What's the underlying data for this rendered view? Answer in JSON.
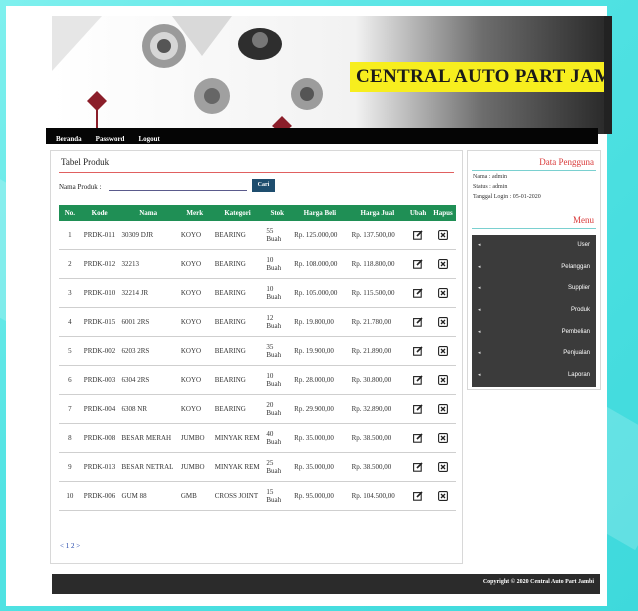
{
  "banner": {
    "title": "CENTRAL AUTO PART JAMBI"
  },
  "nav": {
    "items": [
      "Beranda",
      "Password",
      "Logout"
    ]
  },
  "main": {
    "title": "Tabel Produk",
    "search": {
      "label": "Nama Produk :",
      "value": "",
      "button": "Cari"
    },
    "columns": [
      "No.",
      "Kode",
      "Nama",
      "Merk",
      "Kategori",
      "Stok",
      "Harga Beli",
      "Harga Jual",
      "Ubah",
      "Hapus"
    ],
    "rows": [
      [
        "1",
        "PRDK-011",
        "30309 DJR",
        "KOYO",
        "BEARING",
        "55 Buah",
        "Rp. 125.000,00",
        "Rp. 137.500,00"
      ],
      [
        "2",
        "PRDK-012",
        "32213",
        "KOYO",
        "BEARING",
        "10 Buah",
        "Rp. 108.000,00",
        "Rp. 118.800,00"
      ],
      [
        "3",
        "PRDK-010",
        "32214 JR",
        "KOYO",
        "BEARING",
        "10 Buah",
        "Rp. 105.000,00",
        "Rp. 115.500,00"
      ],
      [
        "4",
        "PRDK-015",
        "6001 2RS",
        "KOYO",
        "BEARING",
        "12 Buah",
        "Rp. 19.800,00",
        "Rp. 21.780,00"
      ],
      [
        "5",
        "PRDK-002",
        "6203 2RS",
        "KOYO",
        "BEARING",
        "35 Buah",
        "Rp. 19.900,00",
        "Rp. 21.890,00"
      ],
      [
        "6",
        "PRDK-003",
        "6304 2RS",
        "KOYO",
        "BEARING",
        "10 Buah",
        "Rp. 28.000,00",
        "Rp. 30.800,00"
      ],
      [
        "7",
        "PRDK-004",
        "6308 NR",
        "KOYO",
        "BEARING",
        "20 Buah",
        "Rp. 29.900,00",
        "Rp. 32.890,00"
      ],
      [
        "8",
        "PRDK-008",
        "BESAR MERAH",
        "JUMBO",
        "MINYAK REM",
        "40 Buah",
        "Rp. 35.000,00",
        "Rp. 38.500,00"
      ],
      [
        "9",
        "PRDK-013",
        "BESAR NETRAL",
        "JUMBO",
        "MINYAK REM",
        "25 Buah",
        "Rp. 35.000,00",
        "Rp. 38.500,00"
      ],
      [
        "10",
        "PRDK-006",
        "GUM 88",
        "GMB",
        "CROSS JOINT",
        "15 Buah",
        "Rp. 95.000,00",
        "Rp. 104.500,00"
      ]
    ],
    "pager": "< 1 2 >"
  },
  "sidebar": {
    "user_title": "Data Pengguna",
    "nama": "Nama : admin",
    "status": "Status : admin",
    "login": "Tanggal Login : 05-01-2020",
    "menu_title": "Menu",
    "menu": [
      "User",
      "Pelanggan",
      "Supplier",
      "Produk",
      "Pembelian",
      "Penjualan",
      "Laporan"
    ]
  },
  "footer": {
    "text": "Copyright © 2020 Central Auto Part Jambi"
  },
  "colors": {
    "header": "#1f8f55",
    "accent": "#d93a3a",
    "banner_title_bg": "#f7ee1e"
  }
}
